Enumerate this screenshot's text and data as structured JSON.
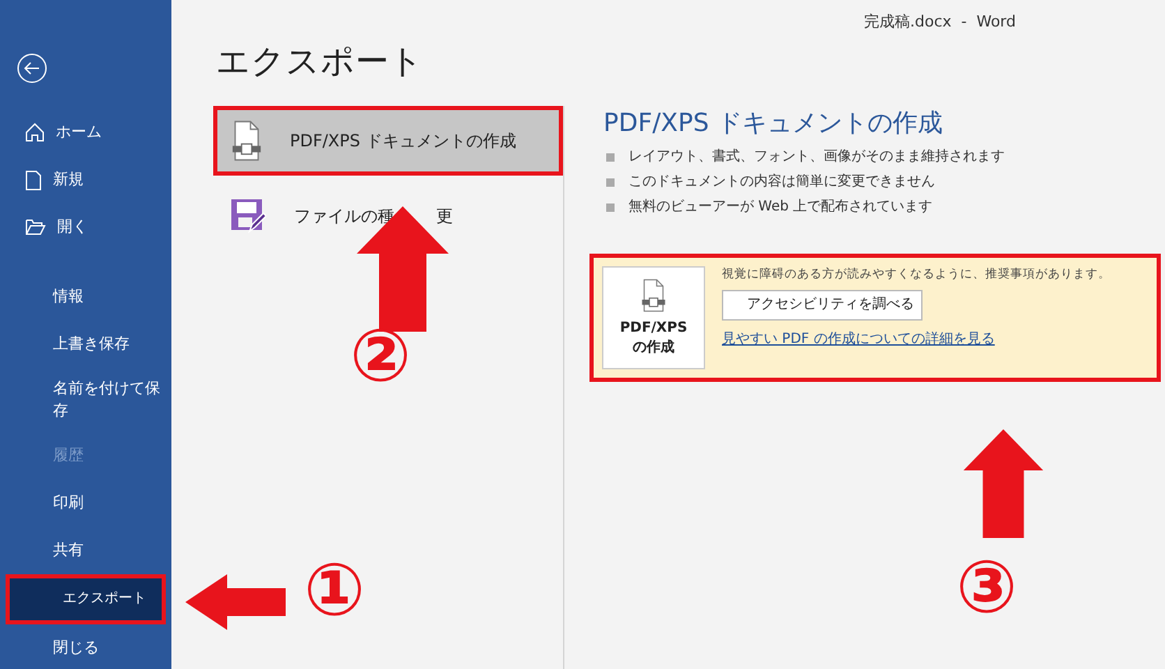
{
  "window": {
    "title": "完成稿.docx  -  Word"
  },
  "sidebar": {
    "top_items": [
      {
        "label": "ホーム",
        "kind": "home"
      },
      {
        "label": "新規",
        "kind": "new"
      },
      {
        "label": "開く",
        "kind": "open"
      }
    ],
    "items": [
      {
        "label": "情報",
        "selected": false,
        "disabled": false
      },
      {
        "label": "上書き保存",
        "selected": false,
        "disabled": false
      },
      {
        "label": "名前を付けて保存",
        "selected": false,
        "disabled": false
      },
      {
        "label": "履歴",
        "selected": false,
        "disabled": true
      },
      {
        "label": "印刷",
        "selected": false,
        "disabled": false
      },
      {
        "label": "共有",
        "selected": false,
        "disabled": false
      },
      {
        "label": "エクスポート",
        "selected": true,
        "disabled": false
      },
      {
        "label": "閉じる",
        "selected": false,
        "disabled": false
      }
    ]
  },
  "page_title": "エクスポート",
  "options": [
    {
      "parts": [
        "PDF/XPS ドキュメントの作成"
      ],
      "kind": "pdf",
      "selected": true
    },
    {
      "parts": [
        "ファイルの種",
        "更"
      ],
      "kind": "save",
      "selected": false
    }
  ],
  "detail": {
    "heading": "PDF/XPS ドキュメントの作成",
    "bullets": [
      "レイアウト、書式、フォント、画像がそのまま維持されます",
      "このドキュメントの内容は簡単に変更できません",
      "無料のビューアーが Web 上で配布されています"
    ],
    "create_button": [
      "PDF/XPS",
      "の作成"
    ],
    "notice": "視覚に障碍のある方が読みやすくなるように、推奨事項があります。",
    "check_button": "アクセシビリティを調べる",
    "link": "見やすい PDF の作成についての詳細を見る"
  },
  "annotations": [
    {
      "label": "①",
      "kind": "left"
    },
    {
      "label": "②",
      "kind": "up"
    },
    {
      "label": "③",
      "kind": "up"
    }
  ]
}
